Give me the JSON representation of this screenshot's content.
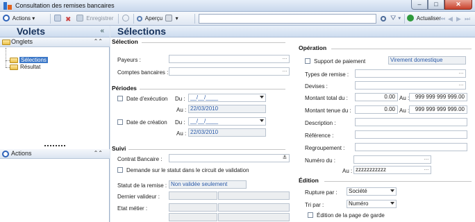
{
  "window": {
    "title": "Consultation des remises bancaires",
    "buttons": [
      "–",
      "□",
      "✕"
    ]
  },
  "toolbar": {
    "actions": "Actions",
    "enregistrer": "Enregistrer",
    "apercu": "Aperçu",
    "actualiser": "Actualiser"
  },
  "left": {
    "title": "Volets",
    "collapse_glyph": "«",
    "onglets": "Onglets",
    "items": [
      "Sélections",
      "Résultat"
    ],
    "actions": "Actions",
    "section_glyph": "»"
  },
  "main": {
    "title": "Sélections",
    "selection": {
      "heading": "Sélection",
      "payeurs": "Payeurs :",
      "comptes": "Comptes bancaires :"
    },
    "periodes": {
      "heading": "Périodes",
      "date_execution": "Date d'exécution",
      "date_creation": "Date de création",
      "du": "Du :",
      "au": "Au :",
      "du_value": "__/__/____",
      "au_value": "22/03/2010"
    },
    "suivi": {
      "heading": "Suivi",
      "contrat": "Contrat Bancaire :",
      "demande": "Demande sur le statut dans le circuit de validation",
      "statut_label": "Statut de la remise :",
      "statut_value": "Non validée seulement",
      "dernier": "Dernier valideur :",
      "etat": "Etat métier :"
    },
    "operation": {
      "heading": "Opération",
      "support": "Support de paiement",
      "support_value": "Virement domestique",
      "types": "Types de remise :",
      "devises": "Devises :",
      "montant_total": "Montant total du :",
      "montant_tenue": "Montant tenue du :",
      "min_value": "0.00",
      "au": "Au :",
      "max_value": "999 999 999 999.00",
      "description": "Description :",
      "reference": "Référence :",
      "regroupement": "Regroupement :",
      "numero": "Numéro du :",
      "numero_au": "Au :",
      "numero_au_value": "zzzzzzzzzzz"
    },
    "edition": {
      "heading": "Édition",
      "rupture": "Rupture par :",
      "rupture_value": "Société",
      "tri": "Tri par :",
      "tri_value": "Numéro",
      "page_garde": "Édition de la page de garde"
    }
  }
}
